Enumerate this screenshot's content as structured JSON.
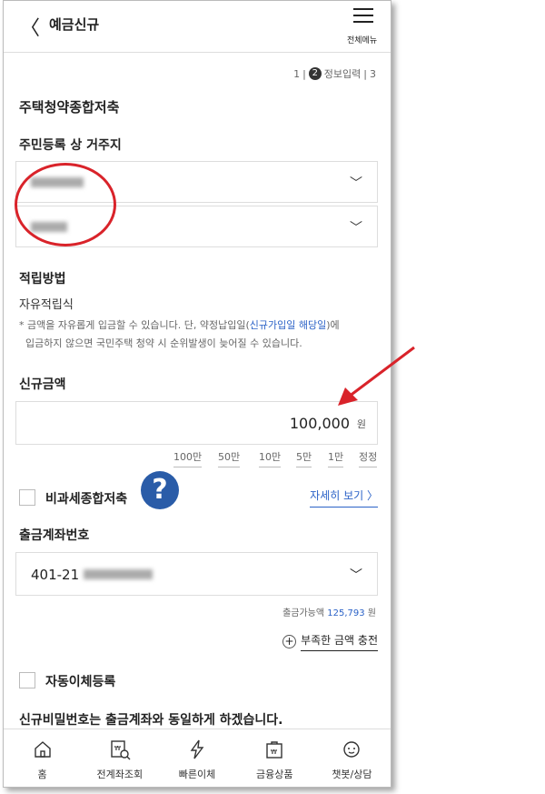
{
  "header": {
    "title": "예금신규",
    "menu_label": "전체메뉴"
  },
  "step": {
    "s1": "1",
    "s2": "2",
    "s2_label": "정보입력",
    "s3": "3"
  },
  "product_name": "주택청약종합저축",
  "address": {
    "label": "주민등록 상 거주지"
  },
  "savings": {
    "label": "적립방법",
    "value": "자유적립식"
  },
  "note": {
    "prefix": "* 금액을 자유롭게 입금할 수 있습니다. 단, 약정납입일(",
    "link": "신규가입일 해당일",
    "suffix": ")에",
    "line2": "입금하지 않으면 국민주택 청약 시 순위발생이 늦어질 수 있습니다."
  },
  "amount": {
    "label": "신규금액",
    "value": "100,000",
    "unit": "원",
    "quick": [
      "100만",
      "50만",
      "10만",
      "5만",
      "1만",
      "정정"
    ]
  },
  "tax_free": {
    "label": "비과세종합저축",
    "detail_link": "자세히 보기 〉"
  },
  "help_icon_glyph": "?",
  "account": {
    "label": "출금계좌번호",
    "value": "401-21",
    "available_label": "출금가능액",
    "available_amount": "125,793",
    "available_unit": "원",
    "charge_label": "부족한 금액 충전"
  },
  "auto_transfer": {
    "label": "자동이체등록"
  },
  "password_note": "신규비밀번호는 출금계좌와 동일하게 하겠습니다.",
  "nav": [
    {
      "label": "홈",
      "icon": "home-icon"
    },
    {
      "label": "전계좌조회",
      "icon": "account-search-icon"
    },
    {
      "label": "빠른이체",
      "icon": "lightning-icon"
    },
    {
      "label": "금융상품",
      "icon": "product-bag-icon"
    },
    {
      "label": "챗봇/상담",
      "icon": "chatbot-icon"
    }
  ],
  "colors": {
    "accent_blue": "#2b62c7",
    "annotation_red": "#d9232a",
    "help_blue": "#2a5ca8"
  }
}
